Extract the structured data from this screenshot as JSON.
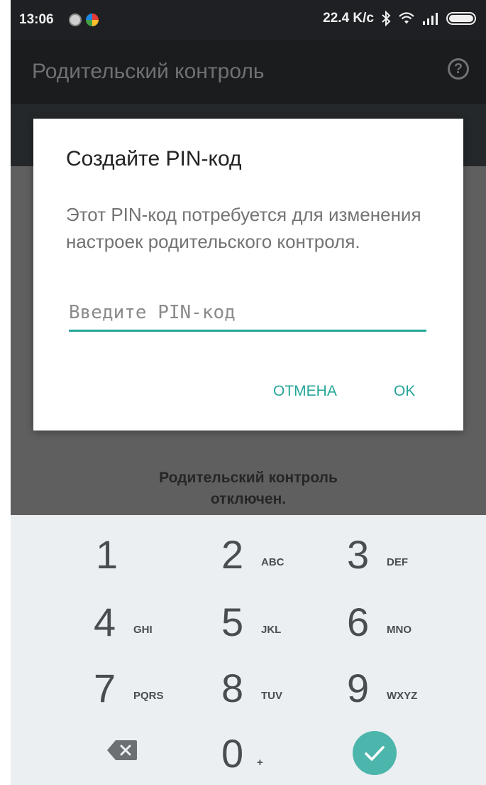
{
  "statusbar": {
    "time": "13:06",
    "speed": "22.4 K/c"
  },
  "appbar": {
    "title": "Родительский контроль"
  },
  "background": {
    "status_line1": "Родительский контроль",
    "status_line2": "отключен."
  },
  "dialog": {
    "title": "Создайте PIN-код",
    "message": "Этот PIN-код потребуется для изменения настроек родительского контроля.",
    "input_placeholder": "Введите PIN-код",
    "input_value": "",
    "cancel_label": "ОТМЕНА",
    "ok_label": "OK"
  },
  "keypad": {
    "keys": [
      {
        "digit": "1",
        "letters": ""
      },
      {
        "digit": "2",
        "letters": "ABC"
      },
      {
        "digit": "3",
        "letters": "DEF"
      },
      {
        "digit": "4",
        "letters": "GHI"
      },
      {
        "digit": "5",
        "letters": "JKL"
      },
      {
        "digit": "6",
        "letters": "MNO"
      },
      {
        "digit": "7",
        "letters": "PQRS"
      },
      {
        "digit": "8",
        "letters": "TUV"
      },
      {
        "digit": "9",
        "letters": "WXYZ"
      },
      {
        "digit": "0",
        "letters": "+"
      }
    ],
    "backspace_icon": "backspace-icon",
    "done_icon": "checkmark-icon"
  },
  "colors": {
    "accent": "#26a69a",
    "done_button": "#4db6ac",
    "keypad_bg": "#eceff1"
  }
}
